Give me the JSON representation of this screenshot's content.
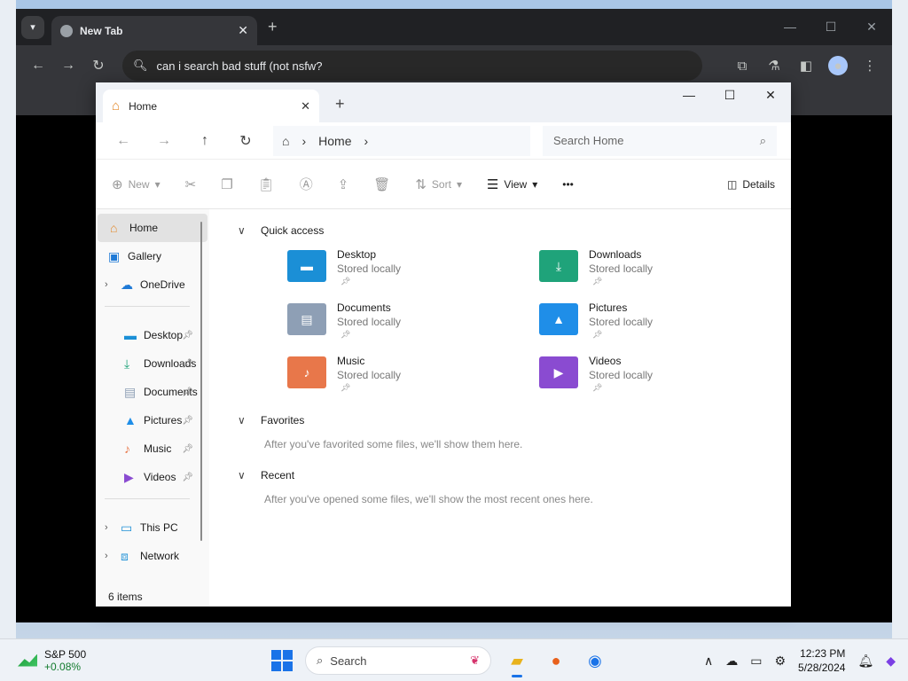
{
  "chrome": {
    "tab_title": "New Tab",
    "omnibox_text": "can i search bad stuff (not nsfw?"
  },
  "explorer": {
    "tab_label": "Home",
    "breadcrumb": "Home",
    "search_placeholder": "Search Home",
    "commands": {
      "new": "New",
      "sort": "Sort",
      "view": "View",
      "more": "•••",
      "details": "Details"
    },
    "nav": {
      "top": [
        {
          "label": "Home",
          "icon": "home-icon"
        },
        {
          "label": "Gallery",
          "icon": "gallery-icon"
        },
        {
          "label": "OneDrive",
          "icon": "onedrive-icon"
        }
      ],
      "pinned": [
        {
          "label": "Desktop",
          "icon": "desktop-folder-icon"
        },
        {
          "label": "Downloads",
          "icon": "downloads-folder-icon"
        },
        {
          "label": "Documents",
          "icon": "documents-folder-icon"
        },
        {
          "label": "Pictures",
          "icon": "pictures-folder-icon"
        },
        {
          "label": "Music",
          "icon": "music-folder-icon"
        },
        {
          "label": "Videos",
          "icon": "videos-folder-icon"
        }
      ],
      "bottom": [
        {
          "label": "This PC",
          "icon": "pc-icon"
        },
        {
          "label": "Network",
          "icon": "network-icon"
        }
      ]
    },
    "status": "6 items",
    "quick_access": {
      "title": "Quick access",
      "items": [
        {
          "name": "Desktop",
          "sub": "Stored locally",
          "color": "#1b8fd6"
        },
        {
          "name": "Downloads",
          "sub": "Stored locally",
          "color": "#1fa37a"
        },
        {
          "name": "Documents",
          "sub": "Stored locally",
          "color": "#8e9fb5"
        },
        {
          "name": "Pictures",
          "sub": "Stored locally",
          "color": "#1f8ee8"
        },
        {
          "name": "Music",
          "sub": "Stored locally",
          "color": "#e8774a"
        },
        {
          "name": "Videos",
          "sub": "Stored locally",
          "color": "#8a4bd1"
        }
      ]
    },
    "favorites": {
      "title": "Favorites",
      "empty": "After you've favorited some files, we'll show them here."
    },
    "recent": {
      "title": "Recent",
      "empty": "After you've opened some files, we'll show the most recent ones here."
    }
  },
  "taskbar": {
    "stock_name": "S&P 500",
    "stock_change": "+0.08%",
    "search_label": "Search",
    "time": "12:23 PM",
    "date": "5/28/2024"
  }
}
